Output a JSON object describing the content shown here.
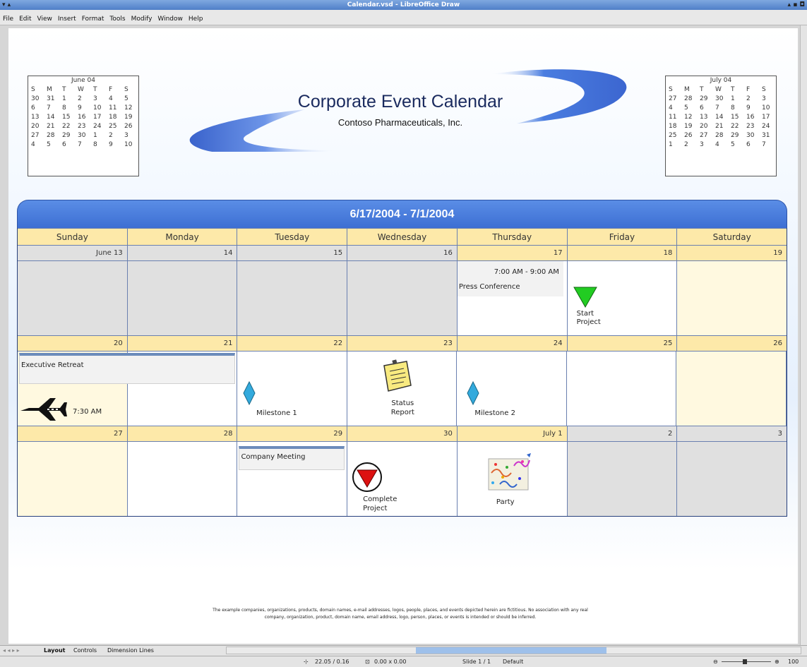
{
  "window": {
    "title": "Calendar.vsd - LibreOffice Draw",
    "left_ctl": "▾ ▴",
    "right_ctl": "▴ ▪ ◘"
  },
  "menu": [
    "File",
    "Edit",
    "View",
    "Insert",
    "Format",
    "Tools",
    "Modify",
    "Window",
    "Help"
  ],
  "header": {
    "title": "Corporate Event Calendar",
    "subtitle": "Contoso Pharmaceuticals, Inc."
  },
  "mini_june": {
    "title": "June 04",
    "days": [
      "S",
      "M",
      "T",
      "W",
      "T",
      "F",
      "S"
    ],
    "weeks": [
      [
        "30",
        "31",
        "1",
        "2",
        "3",
        "4",
        "5"
      ],
      [
        "6",
        "7",
        "8",
        "9",
        "10",
        "11",
        "12"
      ],
      [
        "13",
        "14",
        "15",
        "16",
        "17",
        "18",
        "19"
      ],
      [
        "20",
        "21",
        "22",
        "23",
        "24",
        "25",
        "26"
      ],
      [
        "27",
        "28",
        "29",
        "30",
        "1",
        "2",
        "3"
      ],
      [
        "4",
        "5",
        "6",
        "7",
        "8",
        "9",
        "10"
      ]
    ]
  },
  "mini_july": {
    "title": "July 04",
    "days": [
      "S",
      "M",
      "T",
      "W",
      "T",
      "F",
      "S"
    ],
    "weeks": [
      [
        "27",
        "28",
        "29",
        "30",
        "1",
        "2",
        "3"
      ],
      [
        "4",
        "5",
        "6",
        "7",
        "8",
        "9",
        "10"
      ],
      [
        "11",
        "12",
        "13",
        "14",
        "15",
        "16",
        "17"
      ],
      [
        "18",
        "19",
        "20",
        "21",
        "22",
        "23",
        "24"
      ],
      [
        "25",
        "26",
        "27",
        "28",
        "29",
        "30",
        "31"
      ],
      [
        "1",
        "2",
        "3",
        "4",
        "5",
        "6",
        "7"
      ]
    ]
  },
  "calendar": {
    "range": "6/17/2004 - 7/1/2004",
    "daynames": [
      "Sunday",
      "Monday",
      "Tuesday",
      "Wednesday",
      "Thursday",
      "Friday",
      "Saturday"
    ],
    "weeks": [
      {
        "dates": [
          "June 13",
          "14",
          "15",
          "16",
          "17",
          "18",
          "19"
        ]
      },
      {
        "dates": [
          "20",
          "21",
          "22",
          "23",
          "24",
          "25",
          "26"
        ]
      },
      {
        "dates": [
          "27",
          "28",
          "29",
          "30",
          "July 1",
          "2",
          "3"
        ]
      }
    ]
  },
  "events": {
    "press_time": "7:00 AM - 9:00 AM",
    "press": "Press Conference",
    "start_project_1": "Start",
    "start_project_2": "Project",
    "exec_retreat": "Executive Retreat",
    "flight_time": "7:30 AM",
    "milestone1": "Milestone 1",
    "status_1": "Status",
    "status_2": "Report",
    "milestone2": "Milestone 2",
    "company_meeting": "Company Meeting",
    "complete_1": "Complete",
    "complete_2": "Project",
    "party": "Party"
  },
  "disclaimer": {
    "line1": "The example companies, organizations, products, domain names, e-mail addresses, logos, people, places, and events depicted herein are fictitious. No association with any real",
    "line2": "company, organization, product, domain name, email address, logo, person, places, or events is intended or should be inferred."
  },
  "tabs": [
    "Layout",
    "Controls",
    "Dimension Lines"
  ],
  "status": {
    "position": "22.05 / 0.16",
    "size": "0.00 x 0.00",
    "slide": "Slide 1 / 1",
    "layout": "Default",
    "zoom": "100"
  }
}
